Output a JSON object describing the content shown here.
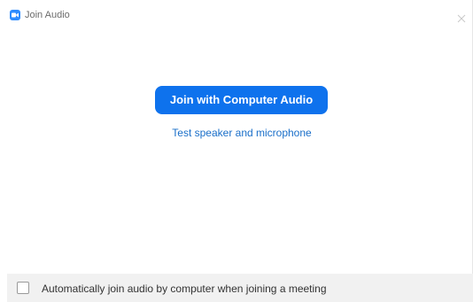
{
  "window": {
    "title": "Join Audio",
    "app_icon": "zoom-camera-icon",
    "close_icon": "close-icon"
  },
  "main": {
    "join_button_label": "Join with Computer Audio",
    "test_link_label": "Test speaker and microphone"
  },
  "footer": {
    "auto_join_label": "Automatically join audio by computer when joining a meeting",
    "auto_join_checked": false
  },
  "colors": {
    "accent": "#0e72ed",
    "app_icon": "#2d8cff",
    "link": "#1a6fc9",
    "footer_bg": "#f1f1f1"
  }
}
